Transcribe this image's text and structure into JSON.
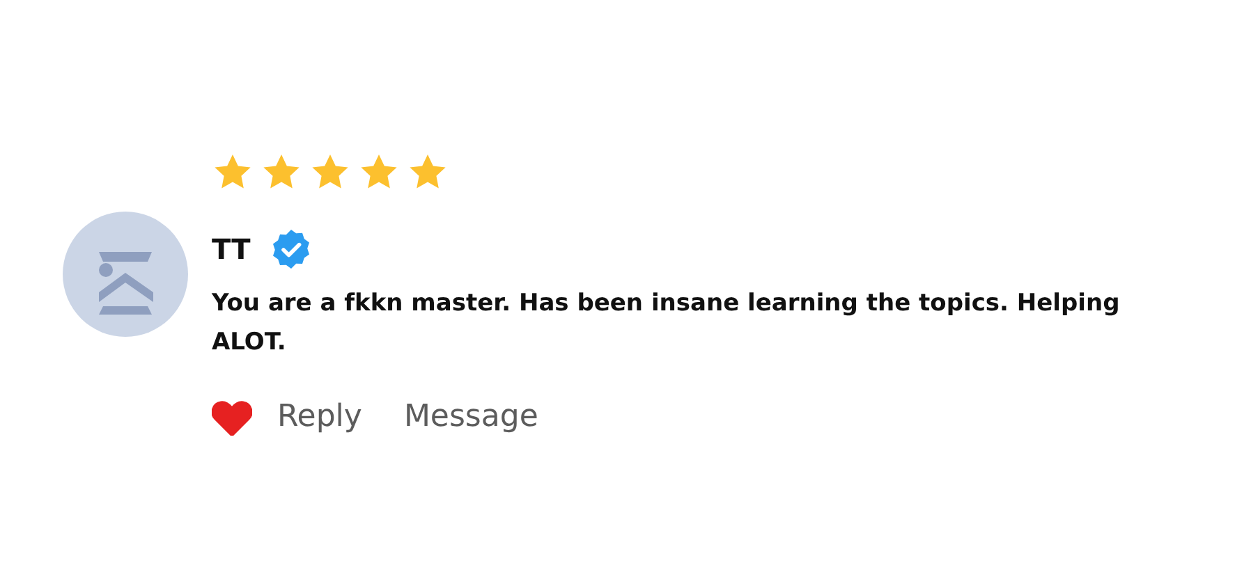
{
  "review": {
    "stars": 5,
    "author": "TT",
    "verified": true,
    "text": "You are a fkkn master. Has been insane learning the topics. Helping ALOT.",
    "liked": true,
    "actions": [
      "Reply",
      "Message"
    ]
  }
}
